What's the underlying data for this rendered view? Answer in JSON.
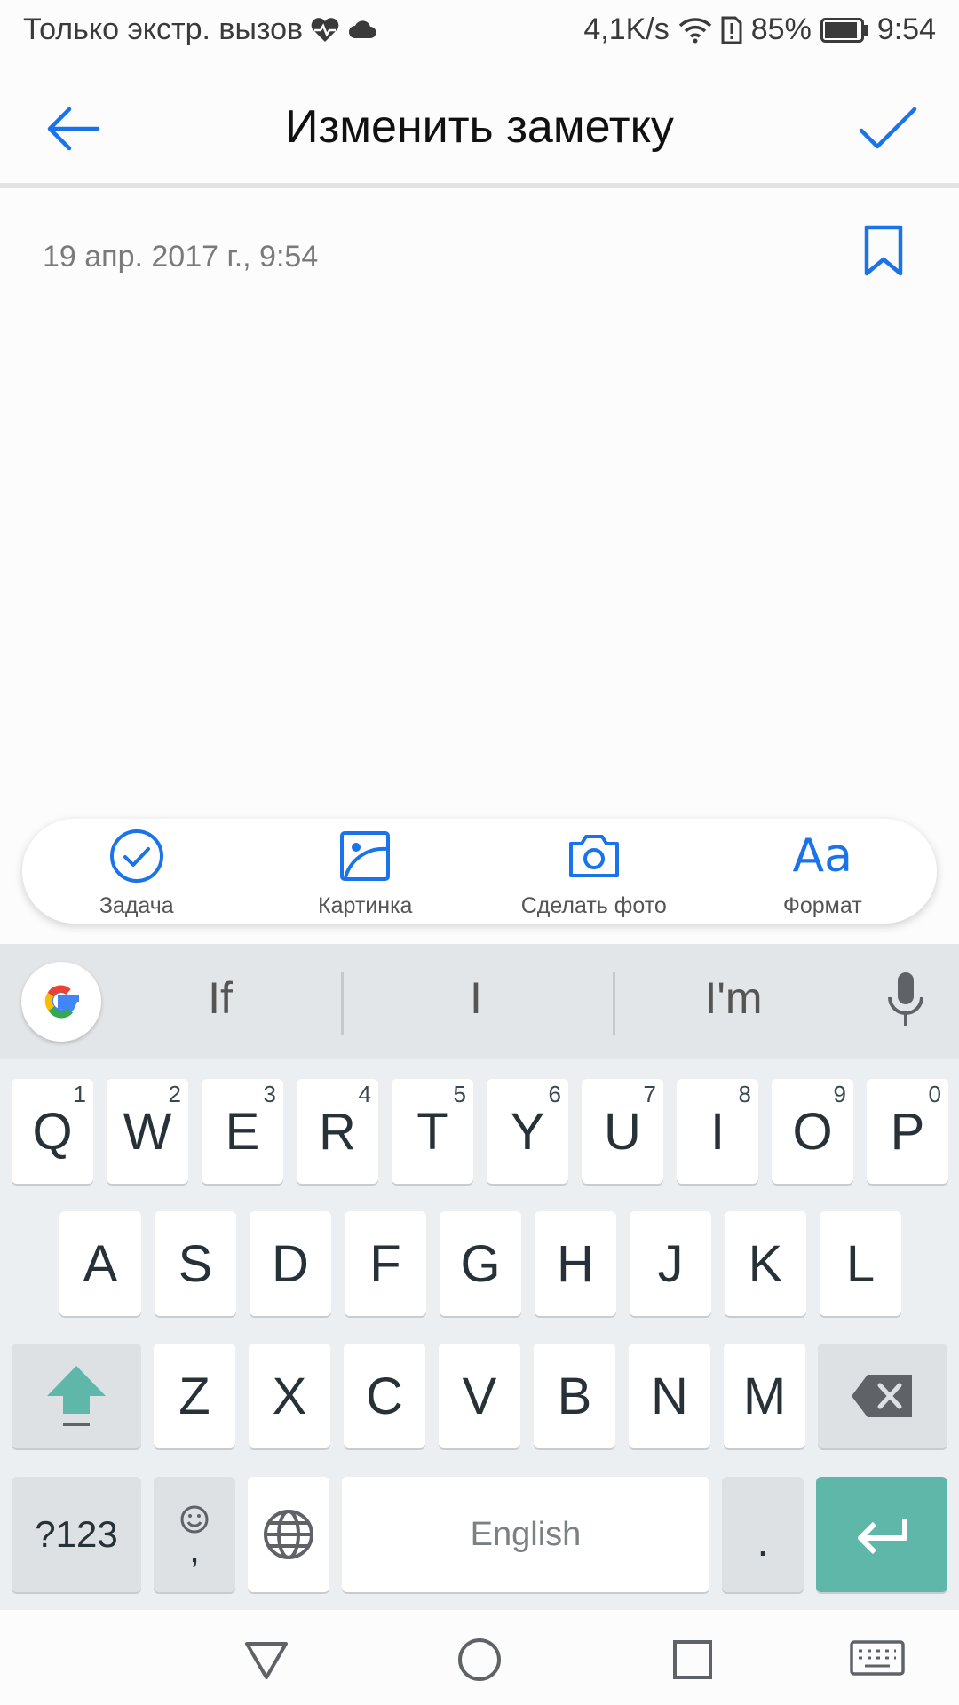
{
  "status_bar": {
    "left_text": "Только экстр. вызов",
    "speed": "4,1K/s",
    "battery": "85%",
    "time": "9:54"
  },
  "app_bar": {
    "title": "Изменить заметку"
  },
  "note": {
    "date": "19 апр. 2017 г., 9:54"
  },
  "toolbar": {
    "items": [
      {
        "label": "Задача",
        "icon": "checklist-icon"
      },
      {
        "label": "Картинка",
        "icon": "image-icon"
      },
      {
        "label": "Сделать фото",
        "icon": "camera-icon"
      },
      {
        "label": "Формат",
        "icon": "format-icon",
        "glyph": "Aa"
      }
    ]
  },
  "keyboard": {
    "suggestions": [
      "If",
      "I",
      "I'm"
    ],
    "row1": [
      {
        "k": "Q",
        "n": "1"
      },
      {
        "k": "W",
        "n": "2"
      },
      {
        "k": "E",
        "n": "3"
      },
      {
        "k": "R",
        "n": "4"
      },
      {
        "k": "T",
        "n": "5"
      },
      {
        "k": "Y",
        "n": "6"
      },
      {
        "k": "U",
        "n": "7"
      },
      {
        "k": "I",
        "n": "8"
      },
      {
        "k": "O",
        "n": "9"
      },
      {
        "k": "P",
        "n": "0"
      }
    ],
    "row2": [
      "A",
      "S",
      "D",
      "F",
      "G",
      "H",
      "J",
      "K",
      "L"
    ],
    "row3": [
      "Z",
      "X",
      "C",
      "V",
      "B",
      "N",
      "M"
    ],
    "symbols_label": "?123",
    "comma_label": ",",
    "space_label": "English",
    "period_label": ".",
    "accent_color": "#5fb7a9"
  },
  "colors": {
    "accent": "#1a73e8"
  }
}
